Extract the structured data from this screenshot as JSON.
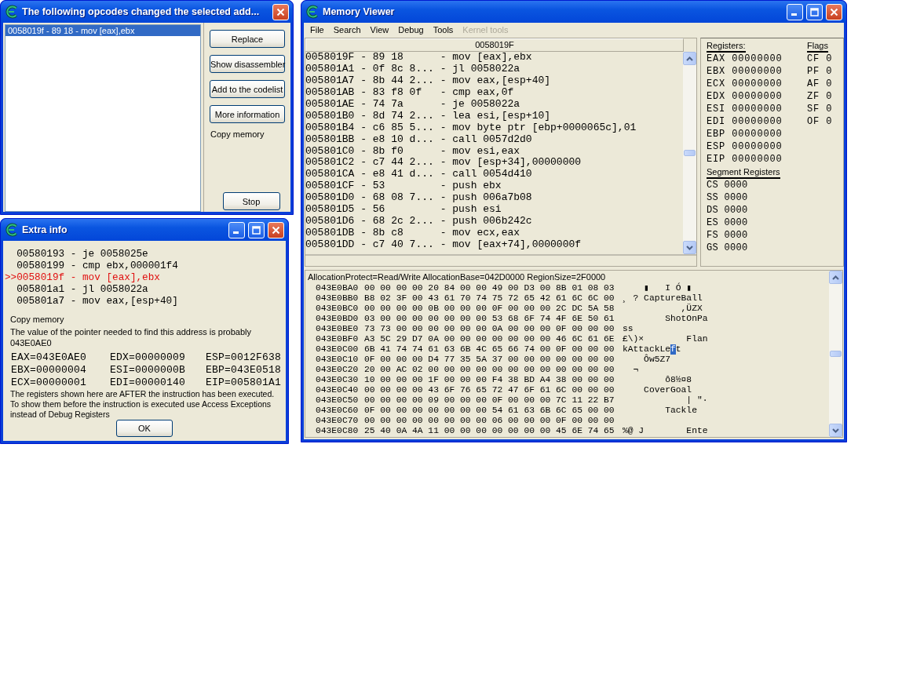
{
  "opcodes_window": {
    "title": "The following opcodes changed the selected add...",
    "controls": [
      {
        "kind": "close"
      }
    ],
    "list": [
      {
        "text": "0058019f - 89 18  - mov [eax],ebx",
        "selected": true
      }
    ],
    "buttons": [
      "Replace",
      "Show disassembler",
      "Add to the codelist",
      "More information"
    ],
    "note": "Copy memory",
    "stop_button": "Stop"
  },
  "extra_info": {
    "title": "Extra info",
    "controls": [
      {
        "kind": "minimize"
      },
      {
        "kind": "maximize"
      },
      {
        "kind": "close"
      }
    ],
    "code": [
      {
        "text": "00580193 - je 0058025e",
        "current": false
      },
      {
        "text": "00580199 - cmp ebx,000001f4",
        "current": false
      },
      {
        "text": ">>0058019f - mov [eax],ebx",
        "current": true
      },
      {
        "text": "005801a1 - jl 0058022a",
        "current": false
      },
      {
        "text": "005801a7 - mov eax,[esp+40]",
        "current": false
      }
    ],
    "copy_memory": "Copy memory",
    "pointer_note": "The value of the pointer needed to find this address is probably",
    "pointer_value": "043E0AE0",
    "registers": [
      "EAX=043E0AE0",
      "EDX=00000009",
      "ESP=0012F638",
      "EBX=00000004",
      "ESI=0000000B",
      "EBP=043E0518",
      "ECX=00000001",
      "EDI=00000140",
      "EIP=005801A1"
    ],
    "note": "The registers shown here are AFTER the instruction has been executed. To show them before the instruction is executed use Access Exceptions instead of Debug Registers",
    "ok_button": "OK"
  },
  "memory_viewer": {
    "title": "Memory Viewer",
    "controls": [
      {
        "kind": "minimize"
      },
      {
        "kind": "maximize"
      },
      {
        "kind": "close"
      }
    ],
    "menu": [
      {
        "label": "File",
        "disabled": false
      },
      {
        "label": "Search",
        "disabled": false
      },
      {
        "label": "View",
        "disabled": false
      },
      {
        "label": "Debug",
        "disabled": false
      },
      {
        "label": "Tools",
        "disabled": false
      },
      {
        "label": "Kernel tools",
        "disabled": true
      }
    ],
    "disasm_header": "0058019F",
    "disasm": [
      "0058019F - 89 18      - mov [eax],ebx",
      "005801A1 - 0f 8c 8... - jl 0058022a",
      "005801A7 - 8b 44 2... - mov eax,[esp+40]",
      "005801AB - 83 f8 0f   - cmp eax,0f",
      "005801AE - 74 7a      - je 0058022a",
      "005801B0 - 8d 74 2... - lea esi,[esp+10]",
      "005801B4 - c6 85 5... - mov byte ptr [ebp+0000065c],01",
      "005801BB - e8 10 d... - call 0057d2d0",
      "005801C0 - 8b f0      - mov esi,eax",
      "005801C2 - c7 44 2... - mov [esp+34],00000000",
      "005801CA - e8 41 d... - call 0054d410",
      "005801CF - 53         - push ebx",
      "005801D0 - 68 08 7... - push 006a7b08",
      "005801D5 - 56         - push esi",
      "005801D6 - 68 2c 2... - push 006b242c",
      "005801DB - 8b c8      - mov ecx,eax",
      "005801DD - c7 40 7... - mov [eax+74],0000000f"
    ],
    "registers_heading": "Registers:",
    "registers": [
      "EAX 00000000",
      "EBX 00000000",
      "ECX 00000000",
      "EDX 00000000",
      "ESI 00000000",
      "EDI 00000000",
      "EBP 00000000",
      "ESP 00000000",
      "EIP 00000000"
    ],
    "flags_heading": "Flags",
    "flags": [
      "CF 0",
      "PF 0",
      "AF 0",
      "ZF 0",
      "SF 0",
      "OF 0"
    ],
    "segment_heading": "Segment Registers",
    "segments": [
      "CS 0000",
      "SS 0000",
      "DS 0000",
      "ES 0000",
      "FS 0000",
      "GS 0000"
    ],
    "region_info": "AllocationProtect=Read/Write  AllocationBase=042D0000 RegionSize=2F0000",
    "hex_rows": [
      {
        "address": "043E0BA0",
        "bytes": "00 00 00 00 20 84 00 00 49 00 D3 00 8B 01 08 03",
        "ascii": "    ▮   I Ó ▮"
      },
      {
        "address": "043E0BB0",
        "bytes": "B8 02 3F 00 43 61 70 74 75 72 65 42 61 6C 6C 00",
        "ascii": "¸ ? CaptureBall"
      },
      {
        "address": "043E0BC0",
        "bytes": "00 00 00 00 0B 00 00 00 0F 00 00 00 2C DC 5A 58",
        "ascii": "           ,ÜZX"
      },
      {
        "address": "043E0BD0",
        "bytes": "03 00 00 00 00 00 00 00 53 68 6F 74 4F 6E 50 61",
        "ascii": "        ShotOnPa"
      },
      {
        "address": "043E0BE0",
        "bytes": "73 73 00 00 00 00 00 00 0A 00 00 00 0F 00 00 00",
        "ascii": "ss"
      },
      {
        "address": "043E0BF0",
        "bytes": "A3 5C 29 D7 0A 00 00 00 00 00 00 00 46 6C 61 6E",
        "ascii": "£\\)×        Flan"
      },
      {
        "address": "043E0C00",
        "bytes": "6B 41 74 74 61 63 6B 4C 65 66 74 00 0F 00 00 00",
        "ascii": "kAttackLe",
        "cursor": "f",
        "ascii_rest": "t"
      },
      {
        "address": "043E0C10",
        "bytes": "0F 00 00 00 D4 77 35 5A 37 00 00 00 00 00 00 00",
        "ascii": "    Ôw5Z7"
      },
      {
        "address": "043E0C20",
        "bytes": "20 00 AC 02 00 00 00 00 00 00 00 00 00 00 00 00",
        "ascii": "  ¬"
      },
      {
        "address": "043E0C30",
        "bytes": "10 00 00 00 1F 00 00 00 F4 38 BD A4 38 00 00 00",
        "ascii": "        ô8½¤8"
      },
      {
        "address": "043E0C40",
        "bytes": "00 00 00 00 43 6F 76 65 72 47 6F 61 6C 00 00 00",
        "ascii": "    CoverGoal"
      },
      {
        "address": "043E0C50",
        "bytes": "00 00 00 00 09 00 00 00 0F 00 00 00 7C 11 22 B7",
        "ascii": "            | \"·"
      },
      {
        "address": "043E0C60",
        "bytes": "0F 00 00 00 00 00 00 00 54 61 63 6B 6C 65 00 00",
        "ascii": "        Tackle"
      },
      {
        "address": "043E0C70",
        "bytes": "00 00 00 00 00 00 00 00 06 00 00 00 0F 00 00 00"
      },
      {
        "address": "043E0C80",
        "bytes": "25 40 0A 4A 11 00 00 00 00 00 00 00 45 6E 74 65",
        "ascii": "%@ J        Ente"
      }
    ]
  }
}
